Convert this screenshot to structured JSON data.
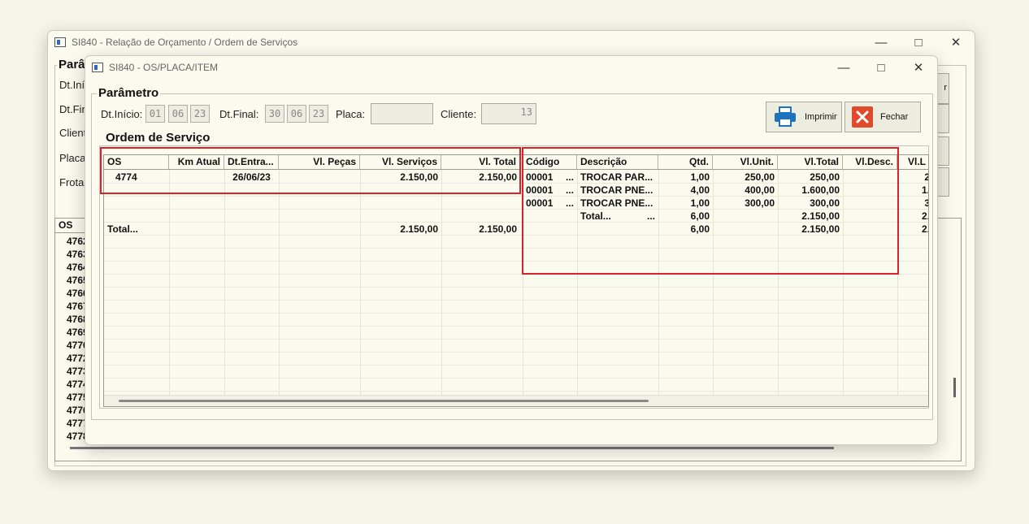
{
  "back_window": {
    "title": "SI840 - Relação de Orçamento / Ordem de Serviços",
    "group_label": "Parâ",
    "field_labels": [
      "Dt.Iníc",
      "Dt.Fin",
      "Client",
      "Placa",
      "Frota"
    ],
    "grid_header": "OS",
    "os_rows": [
      "4762",
      "4763",
      "4764",
      "4765",
      "4766",
      "4767",
      "4768",
      "4769",
      "4770",
      "4772",
      "4773",
      "4774",
      "4775",
      "4776",
      "4777",
      "4778"
    ],
    "button_fragment": "r"
  },
  "front_window": {
    "title": "SI840 - OS/PLACA/ITEM",
    "parametro_label": "Parâmetro",
    "dt_inicio_label": "Dt.Início:",
    "dt_inicio": [
      "01",
      "06",
      "23"
    ],
    "dt_final_label": "Dt.Final:",
    "dt_final": [
      "30",
      "06",
      "23"
    ],
    "placa_label": "Placa:",
    "placa_value": "",
    "cliente_label": "Cliente:",
    "cliente_value": "13",
    "imprimir_label": "Imprimir",
    "fechar_label": "Fechar",
    "ordem_label": "Ordem de Serviço"
  },
  "os_grid": {
    "headers": [
      "OS",
      "Km Atual",
      "Dt.Entra...",
      "Vl. Peças",
      "Vl. Serviços",
      "Vl. Total"
    ],
    "rows": [
      [
        "4774",
        "",
        "26/06/23",
        "",
        "2.150,00",
        "2.150,00"
      ]
    ],
    "total_row": [
      "Total...",
      "",
      "",
      "",
      "2.150,00",
      "2.150,00"
    ]
  },
  "item_grid": {
    "headers": [
      "Código",
      "Descrição",
      "Qtd.",
      "Vl.Unit.",
      "Vl.Total",
      "Vl.Desc.",
      "Vl.L"
    ],
    "rows": [
      [
        "00001",
        "...",
        "TROCAR PAR...",
        "1,00",
        "250,00",
        "250,00",
        "",
        "2"
      ],
      [
        "00001",
        "...",
        "TROCAR PNE...",
        "4,00",
        "400,00",
        "1.600,00",
        "",
        "1."
      ],
      [
        "00001",
        "...",
        "TROCAR PNE...",
        "1,00",
        "300,00",
        "300,00",
        "",
        "3"
      ]
    ],
    "subtotal_row": [
      "Total...",
      "...",
      "6,00",
      "2.150,00",
      "2."
    ],
    "total_row": [
      "6,00",
      "2.150,00",
      "2."
    ]
  },
  "colors": {
    "highlight": "#d8232a",
    "printer_icon": "#1e73be",
    "close_icon": "#e04a2a"
  },
  "icons": {
    "printer": "printer-icon",
    "close": "close-x-icon"
  }
}
